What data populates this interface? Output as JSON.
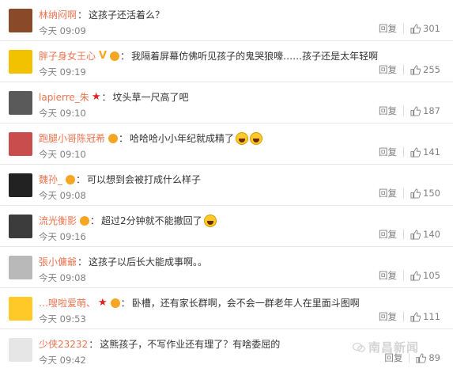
{
  "comments": [
    {
      "username": "林纳闷啊",
      "badges": [],
      "text": "这孩子还活着么？",
      "emoji_count": 0,
      "time": "今天 09:09",
      "reply_label": "回复",
      "likes": "301",
      "avatar_color": "#8a4a2a"
    },
    {
      "username": "胖子身女王心",
      "badges": [
        "v",
        "vip"
      ],
      "text": "我隔着屏幕仿佛听见孩子的鬼哭狼嚎……孩子还是太年轻啊",
      "emoji_count": 0,
      "time": "今天 09:19",
      "reply_label": "回复",
      "likes": "255",
      "avatar_color": "#f2c200"
    },
    {
      "username": "lapierre_朱",
      "badges": [
        "star"
      ],
      "text": "坟头草一尺高了吧",
      "emoji_count": 0,
      "time": "今天 09:10",
      "reply_label": "回复",
      "likes": "187",
      "avatar_color": "#5a5a5a"
    },
    {
      "username": "跑腿小哥陈冠希",
      "badges": [
        "vip"
      ],
      "text": "哈哈哈小小年纪就成精了",
      "emoji_count": 2,
      "time": "今天 09:10",
      "reply_label": "回复",
      "likes": "141",
      "avatar_color": "#c94d4d"
    },
    {
      "username": "魏孙_",
      "badges": [
        "vip"
      ],
      "text": "可以想到会被打成什么样子",
      "emoji_count": 0,
      "time": "今天 09:08",
      "reply_label": "回复",
      "likes": "150",
      "avatar_color": "#222222"
    },
    {
      "username": "流光衡影",
      "badges": [
        "vip"
      ],
      "text": "超过2分钟就不能撤回了",
      "emoji_count": 1,
      "time": "今天 09:16",
      "reply_label": "回复",
      "likes": "140",
      "avatar_color": "#3c3c3c"
    },
    {
      "username": "張小傭爺",
      "badges": [],
      "text": "这孩子以后长大能成事啊。。",
      "emoji_count": 0,
      "time": "今天 09:08",
      "reply_label": "回复",
      "likes": "105",
      "avatar_color": "#b9b9b9"
    },
    {
      "username": "…嗖啦爱萌、",
      "badges": [
        "star",
        "vip"
      ],
      "text": "卧槽，还有家长群啊，会不会一群老年人在里面斗图啊",
      "emoji_count": 0,
      "time": "今天 09:53",
      "reply_label": "回复",
      "likes": "111",
      "avatar_color": "#ffc928"
    },
    {
      "username": "少侠23232",
      "badges": [],
      "text": "这熊孩子，不写作业还有理了？有啥委屈的",
      "emoji_count": 0,
      "time": "今天 09:42",
      "reply_label": "回复",
      "likes": "89",
      "avatar_color": "#e6e6e6"
    }
  ],
  "watermark": {
    "text": "南昌新闻"
  },
  "colors": {
    "username": "#eb7350",
    "meta": "#808080",
    "divider": "#e6e6e6"
  },
  "icons": {
    "like": "thumbs-up-icon",
    "reply": "reply-text",
    "watermark": "wechat-icon"
  }
}
